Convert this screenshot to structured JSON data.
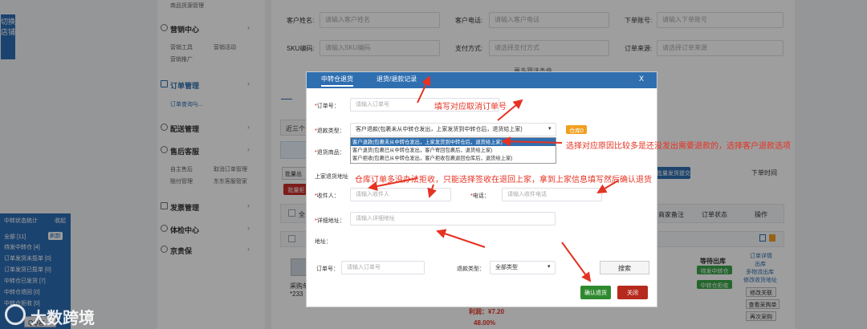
{
  "left_tab": {
    "text": "切换店铺"
  },
  "sidebar": {
    "top_item": "商品货源管理",
    "marketing": {
      "title": "营销中心",
      "items": [
        "营销工具",
        "营销活动",
        "营销推广"
      ]
    },
    "orders": {
      "title": "订单管理",
      "items": [
        "订单查询与..."
      ]
    },
    "delivery": {
      "title": "配送管理"
    },
    "after_sales": {
      "title": "售后客服",
      "items": [
        "自主售后",
        "取消订单管理",
        "赔付管理",
        "东东客服管家"
      ]
    },
    "invoice": {
      "title": "发票管理"
    },
    "experience": {
      "title": "体检中心"
    },
    "jd_guarantee": {
      "title": "京贵保"
    }
  },
  "filters": {
    "customer_name_label": "客户姓名:",
    "customer_name_ph": "请输入客户姓名",
    "customer_phone_label": "客户电话:",
    "customer_phone_ph": "请输入客户电话",
    "order_account_label": "下单账号:",
    "order_account_ph": "请输入下单账号",
    "sku_label": "SKU编码:",
    "sku_ph": "请输入SKU编码",
    "payment_label": "支付方式:",
    "payment_ph": "请选择支付方式",
    "source_label": "订单来源:",
    "source_ph": "请选择订单来源",
    "more": "更多筛选条件",
    "recent_tab": "近三个",
    "batch_btn": "批量出",
    "batch_red": "批量拒",
    "download_sort": "下单时间",
    "select_all": "全",
    "merchant_remark": "商家备注",
    "order_status": "订单状态",
    "actions": "操作",
    "submit_btn": "批量发货提交"
  },
  "order_row": {
    "purchase": "采购单",
    "num": "*233",
    "profit": "利润：¥7.20",
    "pct": "48.00%",
    "status1": "等待出库",
    "badge1": "待发中转仓",
    "badge2": "中转仓拒收",
    "links": [
      "订单详情",
      "出库",
      "多物流出库",
      "修改收货地址"
    ],
    "btns": [
      "修改关联",
      "查看采购单",
      "再次采购"
    ]
  },
  "transit_box": {
    "title": "中转状态统计",
    "collapse": "收起",
    "refresh": "刷新",
    "items": [
      "全部 [11]",
      "待发中转仓 [4]",
      "订单发货未揽单 [0]",
      "订单发货已揽单 [0]",
      "中转仓已发货 [7]",
      "中转仓退回 [0]",
      "中转仓拒收 [0]"
    ],
    "qq": "QQ客"
  },
  "watermark": "大数跨境",
  "modal": {
    "tab_active": "中转仓退货",
    "tab2": "退货/退款记录",
    "close": "X",
    "order_no_label": "订单号：",
    "order_no_ph": "请输入订单号",
    "refund_type_label": "退款类型：",
    "refund_type_value": "客户退款(包裹未从中转仓发出，上家发货到中转仓后，退货给上家)",
    "refund_options": [
      "客户退款(包裹未从中转仓发出，上家发货到中转仓后，退货给上家)",
      "客户退货(包裹已从中转仓发出，客户寄回包裹后，退货给上家)",
      "客户拒收(包裹已从中转仓发出，客户拒收包裹退回仓库后，退货给上家)"
    ],
    "warehouse_btn": "仓库0",
    "return_goods_label": "退货商品：",
    "supplier_addr_label": "上家退货地址",
    "recipient_label": "收件人：",
    "recipient_ph": "请输入收件人",
    "phone_label": "电话：",
    "phone_ph": "请输入收件电话",
    "detail_addr_label": "详细地址：",
    "detail_addr_ph": "请输入详细地址",
    "addr_label": "地址：",
    "q_order_label": "订单号：",
    "q_order_ph": "请输入订单号",
    "q_type_label": "退款类型：",
    "q_type_value": "全部类型",
    "search_btn": "搜索",
    "confirm_btn": "确认退货",
    "cancel_btn": "关闭"
  },
  "annotations": {
    "a1": "填写对应取消订单号",
    "a2": "选择对应原因比较多是还没发出需要退款的，选择客户退款选项",
    "a3": "仓库订单多没办法拒收，只能选择签收在退回上家，拿到上家信息填写然后确认退货"
  }
}
